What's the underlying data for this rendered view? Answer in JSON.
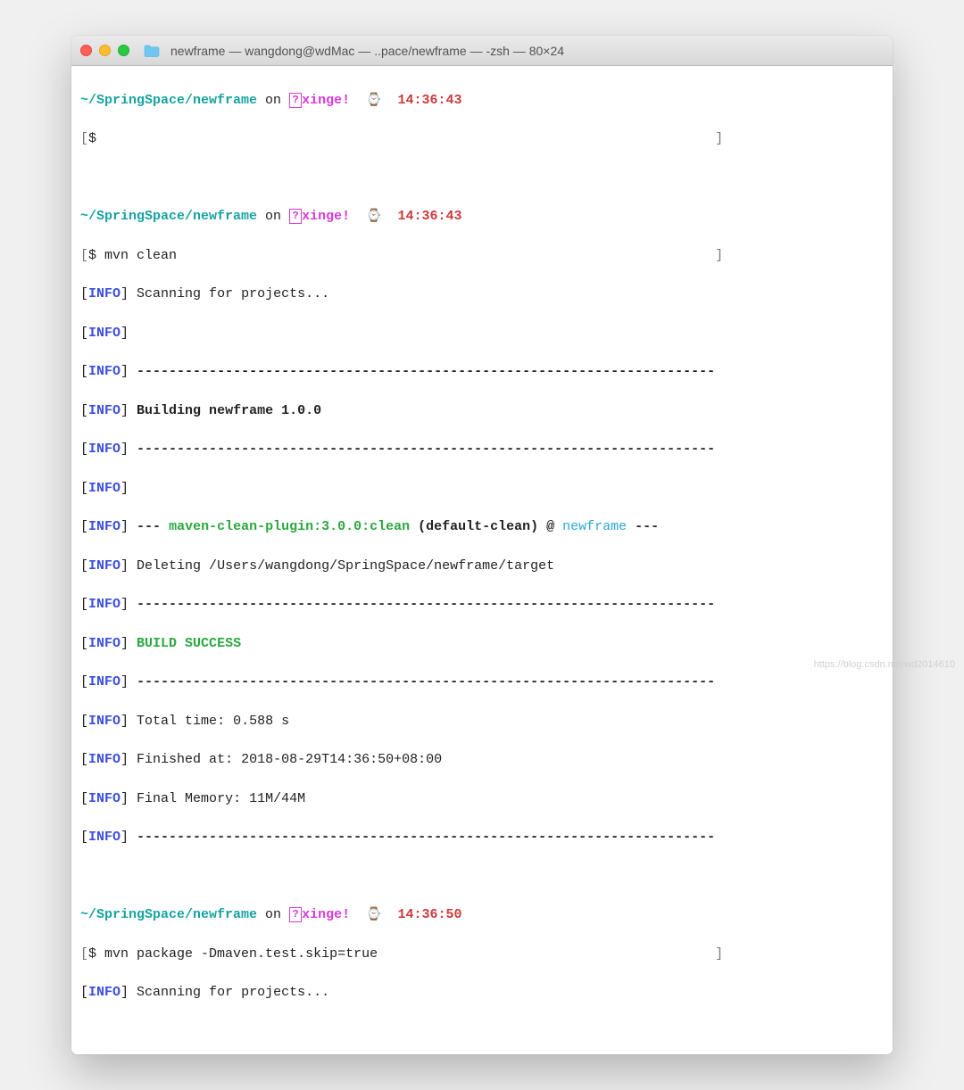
{
  "window": {
    "title": "newframe — wangdong@wdMac — ..pace/newframe — -zsh — 80×24"
  },
  "prompt": {
    "path": "~/SpringSpace/newframe",
    "on": " on ",
    "branch": "xinge!",
    "watch_emoji": "⌚️",
    "t1": "14:36:43",
    "t2": "14:36:43",
    "t3": "14:36:50",
    "ps": "$ ",
    "cmd1": "",
    "cmd2": "mvn clean",
    "cmd3": "mvn package -Dmaven.test.skip=true"
  },
  "tags": {
    "info": "INFO",
    "lb": "[",
    "rb": "]",
    "lbf": "[",
    "rbf": "]"
  },
  "log": {
    "scanning": " Scanning for projects...",
    "dashes": " ------------------------------------------------------------------------",
    "building": " Building newframe 1.0.0",
    "dash3": " --- ",
    "plugin": "maven-clean-plugin:3.0.0:clean",
    "default": " (default-clean)",
    "at": " @ ",
    "proj": "newframe",
    "dashend": " ---",
    "deleting": " Deleting /Users/wangdong/SpringSpace/newframe/target",
    "success": " BUILD SUCCESS",
    "total": " Total time: 0.588 s",
    "finished": " Finished at: 2018-08-29T14:36:50+08:00",
    "memory": " Final Memory: 11M/44M"
  },
  "watermark": "https://blog.csdn.net/wd2014610"
}
